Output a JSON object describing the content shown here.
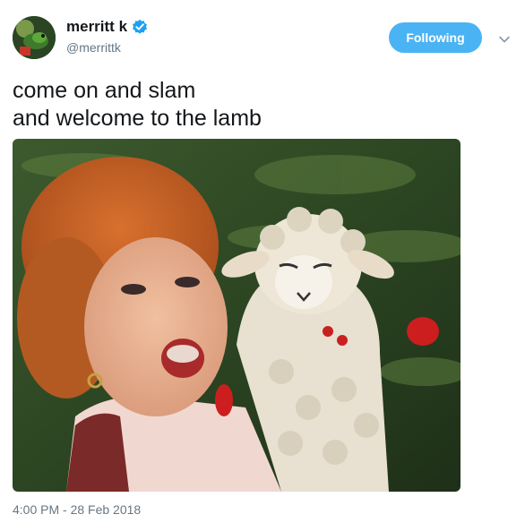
{
  "tweet": {
    "display_name": "merritt k",
    "handle": "@merrittk",
    "follow_label": "Following",
    "text_lines": [
      "come on and slam",
      "and welcome to the lamb"
    ],
    "timestamp": "4:00 PM - 28 Feb 2018"
  },
  "colors": {
    "accent": "#4ab3f4",
    "verified": "#1da1f2",
    "secondary_text": "#657786"
  },
  "icons": {
    "verified": "verified-badge-icon",
    "caret": "chevron-down-icon"
  }
}
